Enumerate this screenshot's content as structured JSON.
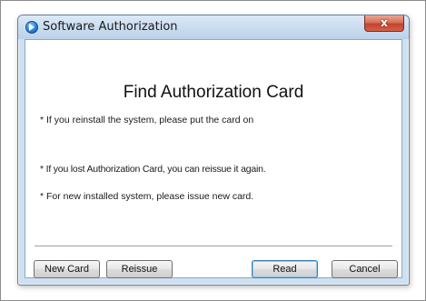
{
  "window": {
    "title": "Software Authorization",
    "close_label": "x"
  },
  "dialog": {
    "heading": "Find Authorization Card",
    "lines": [
      "* If you reinstall the system, please put the card on",
      "* If you lost Authorization Card, you can reissue it again.",
      "* For new installed system, please issue new card."
    ]
  },
  "buttons": {
    "new_card": "New Card",
    "reissue": "Reissue",
    "read": "Read",
    "cancel": "Cancel"
  },
  "icons": {
    "title_icon": "app-icon",
    "close_icon": "close-icon"
  }
}
